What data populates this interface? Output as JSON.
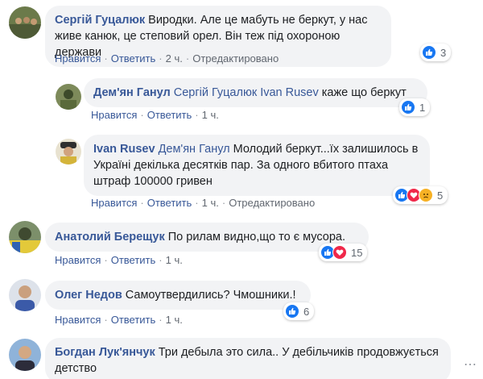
{
  "comments": [
    {
      "author": "Сергій Гуцалюк",
      "mention": "",
      "text": "Виродки. Але це мабуть не беркут, у нас живе канюк, це степовий орел. Він теж під охороною держави",
      "actions": {
        "like": "Нравится",
        "reply": "Ответить",
        "time": "2 ч.",
        "edited": "Отредактировано"
      },
      "reaction_count": "3"
    },
    {
      "author": "Дем'ян Ганул",
      "mention": "Сергій Гуцалюк Ivan Rusev",
      "text": "каже що беркут",
      "actions": {
        "like": "Нравится",
        "reply": "Ответить",
        "time": "1 ч."
      },
      "reaction_count": "1"
    },
    {
      "author": "Ivan Rusev",
      "mention": "Дем'ян Ганул",
      "text": "Молодий беркут...їх залишилось в Україні декілька десятків пар. За одного вбитого птаха штраф 100000 гривен",
      "actions": {
        "like": "Нравится",
        "reply": "Ответить",
        "time": "1 ч.",
        "edited": "Отредактировано"
      },
      "reaction_count": "5"
    },
    {
      "author": "Анатолий Берещук",
      "mention": "",
      "text": "По рилам видно,що то є мусора.",
      "actions": {
        "like": "Нравится",
        "reply": "Ответить",
        "time": "1 ч."
      },
      "reaction_count": "15"
    },
    {
      "author": "Олег Недов",
      "mention": "",
      "text": "Самоутвердились? Чмошники.!",
      "actions": {
        "like": "Нравится",
        "reply": "Ответить",
        "time": "1 ч."
      },
      "reaction_count": "6"
    },
    {
      "author": "Богдан Лук'янчук",
      "mention": "",
      "text": "Три дебыла это сила.. У дебільчиків продовжується детство",
      "actions": {},
      "reaction_count": ""
    }
  ],
  "colors": {
    "link": "#385898",
    "bubble": "#f2f3f5",
    "like": "#1877f2",
    "love": "#f0284a",
    "sad": "#f7b125"
  }
}
